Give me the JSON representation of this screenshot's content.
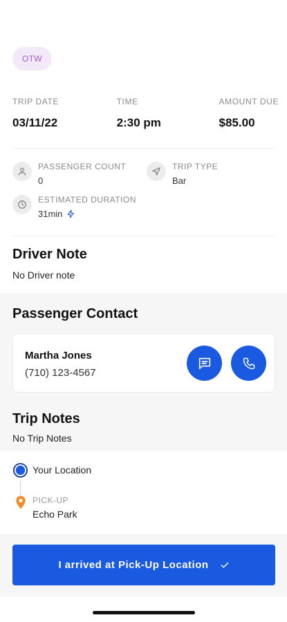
{
  "status": {
    "label": "OTW"
  },
  "trip_info": [
    {
      "label": "TRIP DATE",
      "value": "03/11/22"
    },
    {
      "label": "TIME",
      "value": "2:30 pm"
    },
    {
      "label": "AMOUNT DUE",
      "value": "$85.00"
    }
  ],
  "meta": {
    "passenger_count": {
      "label": "PASSENGER COUNT",
      "value": "0",
      "icon": "user-icon"
    },
    "trip_type": {
      "label": "TRIP TYPE",
      "value": "Bar",
      "icon": "navigation-arrow-icon"
    },
    "estimated_duration": {
      "label": "ESTIMATED DURATION",
      "value": "31min",
      "icon": "clock-icon",
      "badge_icon": "lightning-icon"
    }
  },
  "driver_note": {
    "title": "Driver Note",
    "text": "No Driver note"
  },
  "passenger_contact": {
    "title": "Passenger Contact",
    "name": "Martha Jones",
    "phone": "(710) 123-4567",
    "message_icon": "message-icon",
    "call_icon": "phone-icon"
  },
  "trip_notes": {
    "title": "Trip Notes",
    "text": "No Trip Notes"
  },
  "route": {
    "origin": {
      "label": "Your Location",
      "icon": "current-location-icon"
    },
    "pickup": {
      "label": "PICK-UP",
      "value": "Echo Park",
      "icon": "map-pin-icon"
    }
  },
  "cta": {
    "label": "I arrived at Pick-Up Location",
    "icon": "check-icon"
  },
  "colors": {
    "primary": "#1a5ae0",
    "chip_bg": "#f3e9f8",
    "chip_text": "#a35bc8",
    "pin": "#f28c28"
  }
}
